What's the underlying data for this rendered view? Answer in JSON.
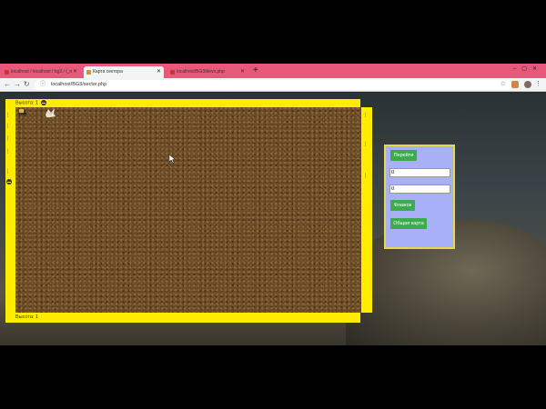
{
  "browser": {
    "tabs": [
      {
        "label": "localhost / localhost / bg3 / t_n"
      },
      {
        "label": "Карта сектора"
      },
      {
        "label": "localhost/BG3/devs.php"
      }
    ],
    "new_tab": "+",
    "url": "localhost/BG3/sector.php"
  },
  "map": {
    "top_label": "Высота: 1",
    "bottom_label": "Высота: 1"
  },
  "panel": {
    "go_button": "Перейти",
    "x_value": "0",
    "y_value": "0",
    "flag_button": "Флажок",
    "global_map_button": "Общая карта"
  },
  "colors": {
    "frame_yellow": "#ffec00",
    "panel_bg": "#a8b0f8",
    "button_green": "#3daa4d",
    "tabbar_pink": "#e8587a"
  }
}
